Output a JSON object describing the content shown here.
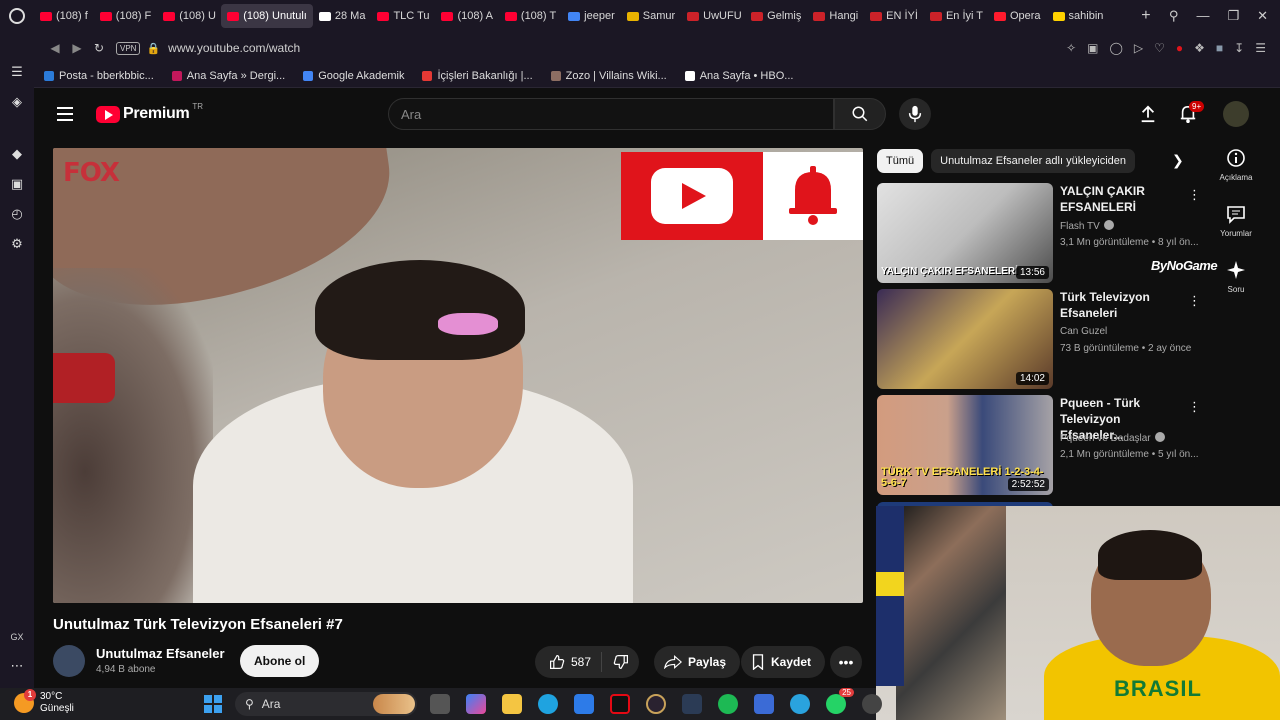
{
  "browser": {
    "tabs": [
      {
        "label": "(108) f",
        "color": "#ff0033"
      },
      {
        "label": "(108) F",
        "color": "#ff0033"
      },
      {
        "label": "(108) U",
        "color": "#ff0033"
      },
      {
        "label": "(108) Unutulı",
        "color": "#ff0033",
        "active": true
      },
      {
        "label": "28 Ma",
        "color": "#ffffff"
      },
      {
        "label": "TLC Tu",
        "color": "#ff0033"
      },
      {
        "label": "(108) A",
        "color": "#ff0033"
      },
      {
        "label": "(108) T",
        "color": "#ff0033"
      },
      {
        "label": "jeeper",
        "color": "#4285f4"
      },
      {
        "label": "Samur",
        "color": "#e9b300"
      },
      {
        "label": "UwUFU",
        "color": "#cc2229"
      },
      {
        "label": "Gelmiş",
        "color": "#cc2229"
      },
      {
        "label": "Hangi",
        "color": "#cc2229"
      },
      {
        "label": "EN İYİ",
        "color": "#cc2229"
      },
      {
        "label": "En İyi T",
        "color": "#cc2229"
      },
      {
        "label": "Opera",
        "color": "#ff1b2d"
      },
      {
        "label": "sahibin",
        "color": "#ffd200"
      }
    ],
    "new_tab": "+",
    "url": "www.youtube.com/watch",
    "vpn_label": "VPN",
    "bookmarks": [
      {
        "label": "Posta - bberkbbic...",
        "color": "#2b7bd9"
      },
      {
        "label": "Ana Sayfa » Dergi...",
        "color": "#c2185b"
      },
      {
        "label": "Google Akademik",
        "color": "#4285f4"
      },
      {
        "label": "İçişleri Bakanlığı |...",
        "color": "#e53935"
      },
      {
        "label": "Zozo | Villains Wiki...",
        "color": "#8d6e63"
      },
      {
        "label": "Ana Sayfa • HBO...",
        "color": "#ffffff"
      }
    ],
    "sidebar_gx": "GX"
  },
  "youtube": {
    "logo_text": "Premium",
    "country_code": "TR",
    "search_placeholder": "Ara",
    "notification_count": "9+",
    "video": {
      "overlay_logo": "FOX",
      "title": "Unutulmaz Türk Televizyon Efsaneleri #7",
      "channel": "Unutulmaz Efsaneler",
      "subscribers": "4,94 B abone",
      "subscribe_label": "Abone ol",
      "likes": "587",
      "share_label": "Paylaş",
      "save_label": "Kaydet"
    },
    "chips": [
      {
        "label": "Tümü",
        "active": true
      },
      {
        "label": "Unutulmaz Efsaneler adlı yükleyiciden",
        "active": false
      }
    ],
    "recommendations": [
      {
        "title": "YALÇIN ÇAKIR EFSANELERİ",
        "channel": "Flash TV",
        "verified": true,
        "meta": "3,1 Mn görüntüleme • 8 yıl ön...",
        "duration": "13:56",
        "thumb_caption": "YALÇIN ÇAKIR EFSANELERİ"
      },
      {
        "title": "Türk Televizyon Efsaneleri",
        "channel": "Can Guzel",
        "verified": false,
        "meta": "73 B görüntüleme • 2 ay önce",
        "duration": "14:02",
        "thumb_caption": ""
      },
      {
        "title": "Pqueen - Türk Televizyon Efsaneler...",
        "channel": "Pqueen ve Dadaşlar",
        "verified": true,
        "meta": "2,1 Mn görüntüleme • 5 yıl ön...",
        "duration": "2:52:52",
        "thumb_caption": "TÜRK TV EFSANELERİ 1-2-3-4-5-6-7"
      }
    ],
    "rail": [
      {
        "label": "Açıklama",
        "icon": "info-icon"
      },
      {
        "label": "Yorumlar",
        "icon": "comments-icon"
      },
      {
        "label": "Soru",
        "icon": "sparkle-icon"
      }
    ],
    "sponsor_overlay": "ByNoGame"
  },
  "webcam": {
    "shirt_text": "BRASIL"
  },
  "taskbar": {
    "temperature": "30°C",
    "weather": "Güneşli",
    "weather_badge": "1",
    "search_placeholder": "Ara",
    "whatsapp_badge": "25"
  }
}
